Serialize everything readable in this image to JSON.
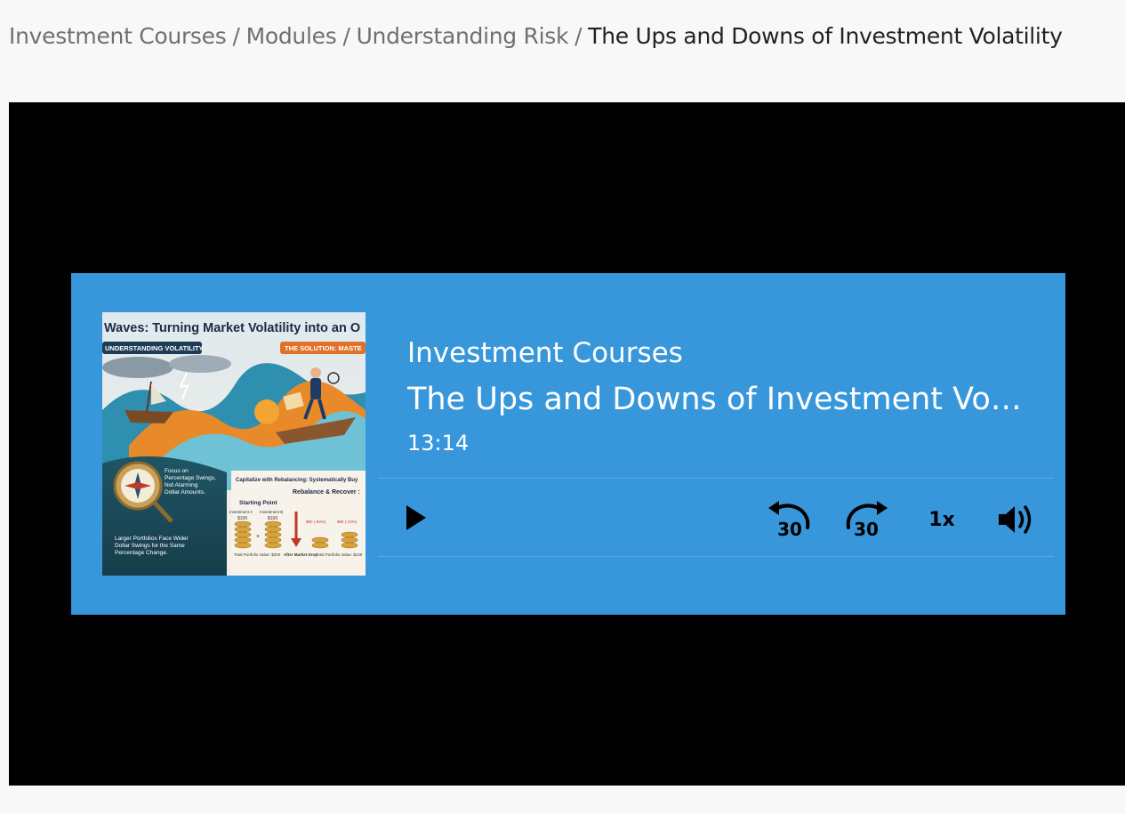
{
  "breadcrumb": {
    "items": [
      "Investment Courses",
      "Modules",
      "Understanding Risk"
    ],
    "current": "The Ups and Downs of Investment Volatility",
    "separator": "/"
  },
  "player": {
    "series": "Investment Courses",
    "title": "The Ups and Downs of Investment Volatility",
    "duration": "13:14",
    "speed": "1x",
    "rewind_seconds": "30",
    "forward_seconds": "30",
    "accent_color": "#3897db"
  },
  "cover": {
    "headline": "Waves: Turning Market Volatility into an O",
    "tag_left": "UNDERSTANDING VOLATILITY",
    "tag_right": "THE SOLUTION: MASTE",
    "focus_text": [
      "Focus on",
      "Percentage Swings,",
      "Not Alarming",
      "Dollar Amounts."
    ],
    "rebalance_heading": "Capitalize with Rebalancing: Systematically Buy",
    "rebalance_sub": "Rebalance & Recover :",
    "starting_point": "Starting Point",
    "inv_a_label": "Investment A",
    "inv_b_label": "Investment B",
    "inv_a_val": "$100",
    "inv_b_val": "$100",
    "drop_a": "$50 (-50%)",
    "drop_b": "$90 (-10%)",
    "total_start": "Total Portfolio Value: $200",
    "after_drop": "After Market Drop",
    "total_after": "Total Portfolio Value: $140",
    "larger_text": [
      "Larger Portfolios Face Wider",
      "Dollar Swings for the Same",
      "Percentage Change."
    ]
  },
  "icons": {
    "play": "play-icon",
    "rewind": "rewind-30-icon",
    "forward": "forward-30-icon",
    "volume": "volume-icon"
  }
}
